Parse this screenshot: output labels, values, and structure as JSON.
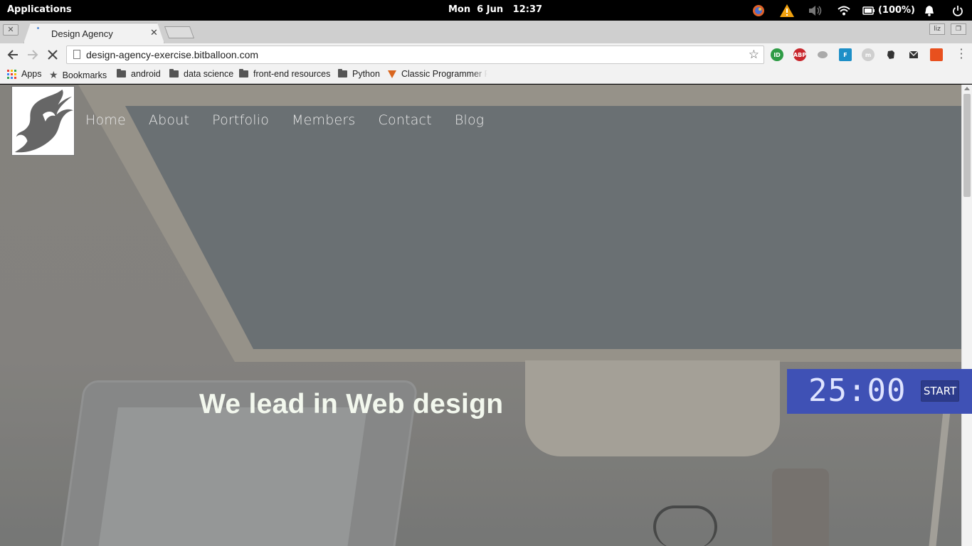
{
  "system_bar": {
    "applications_label": "Applications",
    "clock": "Mon  6 Jun   12:37",
    "battery": "(100%)",
    "tray_icons": [
      "firefox-icon",
      "warning-icon",
      "volume-icon",
      "wifi-icon",
      "battery-icon",
      "notification-bell-icon",
      "power-icon"
    ]
  },
  "browser": {
    "tab": {
      "title": "Design Agency"
    },
    "address": {
      "url": "design-agency-exercise.bitballoon.com"
    },
    "extensions": [
      {
        "name": "ID",
        "color": "#2e9b45"
      },
      {
        "name": "ABP",
        "color": "#c8262c"
      },
      {
        "name": "",
        "color": "#aaaaaa"
      },
      {
        "name": "F",
        "color": "#1d8fc7"
      },
      {
        "name": "m",
        "color": "#cfcfcf"
      },
      {
        "name": "",
        "color": "#333333"
      },
      {
        "name": "",
        "color": "#333333"
      },
      {
        "name": "",
        "color": "#e8501e"
      }
    ],
    "bookmarks": [
      {
        "label": "Apps",
        "icon": "apps-grid-icon"
      },
      {
        "label": "Bookmarks",
        "icon": "star-icon"
      },
      {
        "label": "android",
        "icon": "folder-icon"
      },
      {
        "label": "data science",
        "icon": "folder-icon"
      },
      {
        "label": "front-end resources",
        "icon": "folder-icon"
      },
      {
        "label": "Python",
        "icon": "folder-icon"
      },
      {
        "label": "Classic Programmer F",
        "icon": "site-icon"
      }
    ]
  },
  "site": {
    "nav": [
      "Home",
      "About",
      "Portfolio",
      "Members",
      "Contact",
      "Blog"
    ],
    "hero_title": "We lead in Web design"
  },
  "timer": {
    "value": "25:00",
    "start_label": "START",
    "color": "#3f51b5"
  }
}
